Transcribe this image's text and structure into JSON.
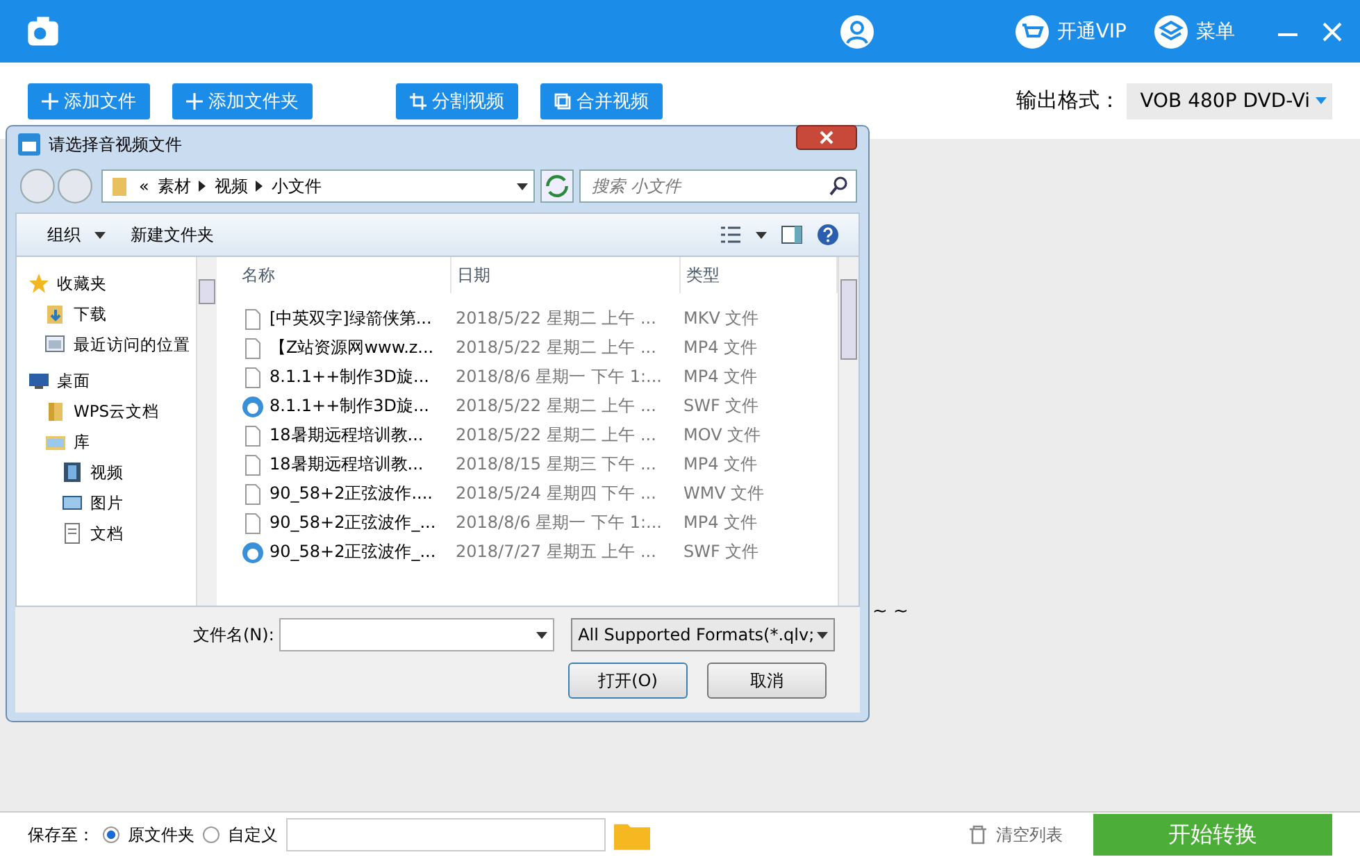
{
  "header": {
    "menu_items": [
      "开通VIP",
      "菜单"
    ]
  },
  "toolbar": {
    "buttons": [
      {
        "label": "添加文件",
        "kind": "plus"
      },
      {
        "label": "添加文件夹",
        "kind": "plus"
      },
      {
        "label": "分割视频",
        "kind": "crop"
      },
      {
        "label": "合并视频",
        "kind": "merge"
      }
    ],
    "output_label": "输出格式：",
    "output_value": "VOB  480P DVD-Vi"
  },
  "background_text": "~ ~",
  "dialog": {
    "title": "请选择音视频文件",
    "breadcrumb": [
      "«",
      "素材",
      "视频",
      "小文件"
    ],
    "search_placeholder": "搜索 小文件",
    "commands": [
      "组织",
      "新建文件夹"
    ],
    "tree": [
      {
        "label": "收藏夹",
        "kind": "star",
        "children": [
          {
            "label": "下载",
            "kind": "download"
          },
          {
            "label": "最近访问的位置",
            "kind": "recent"
          }
        ]
      },
      {
        "label": "桌面",
        "kind": "desktop",
        "children": [
          {
            "label": "WPS云文档",
            "kind": "folder"
          },
          {
            "label": "库",
            "kind": "library",
            "children": [
              {
                "label": "视频",
                "kind": "film"
              },
              {
                "label": "图片",
                "kind": "picture"
              },
              {
                "label": "文档",
                "kind": "document"
              }
            ]
          }
        ]
      }
    ],
    "columns": [
      "名称",
      "日期",
      "类型"
    ],
    "files": [
      {
        "name": "[中英双字]绿箭侠第...",
        "date": "2018/5/22 星期二 上午 ...",
        "type": "MKV 文件",
        "kind": "video"
      },
      {
        "name": "【Z站资源网www.z...",
        "date": "2018/5/22 星期二 上午 ...",
        "type": "MP4 文件",
        "kind": "video"
      },
      {
        "name": "8.1.1++制作3D旋...",
        "date": "2018/8/6 星期一 下午 1:...",
        "type": "MP4 文件",
        "kind": "video"
      },
      {
        "name": "8.1.1++制作3D旋...",
        "date": "2018/5/22 星期二 上午 ...",
        "type": "SWF 文件",
        "kind": "swf"
      },
      {
        "name": "18暑期远程培训教...",
        "date": "2018/5/22 星期二 上午 ...",
        "type": "MOV 文件",
        "kind": "video"
      },
      {
        "name": "18暑期远程培训教...",
        "date": "2018/8/15 星期三 下午 ...",
        "type": "MP4 文件",
        "kind": "video"
      },
      {
        "name": "90_58+2正弦波作....",
        "date": "2018/5/24 星期四 下午 ...",
        "type": "WMV 文件",
        "kind": "video"
      },
      {
        "name": "90_58+2正弦波作_...",
        "date": "2018/8/6 星期一 下午 1:...",
        "type": "MP4 文件",
        "kind": "video"
      },
      {
        "name": "90_58+2正弦波作_...",
        "date": "2018/7/27 星期五 上午 ...",
        "type": "SWF 文件",
        "kind": "swf"
      }
    ],
    "filename_label": "文件名(N):",
    "filter": "All Supported Formats(*.qlv;",
    "open_button": "打开(O)",
    "cancel_button": "取消"
  },
  "bottom": {
    "save_label": "保存至：",
    "options": [
      {
        "label": "原文件夹",
        "selected": true
      },
      {
        "label": "自定义",
        "selected": false
      }
    ],
    "clear_label": "清空列表",
    "start_button": "开始转换"
  }
}
